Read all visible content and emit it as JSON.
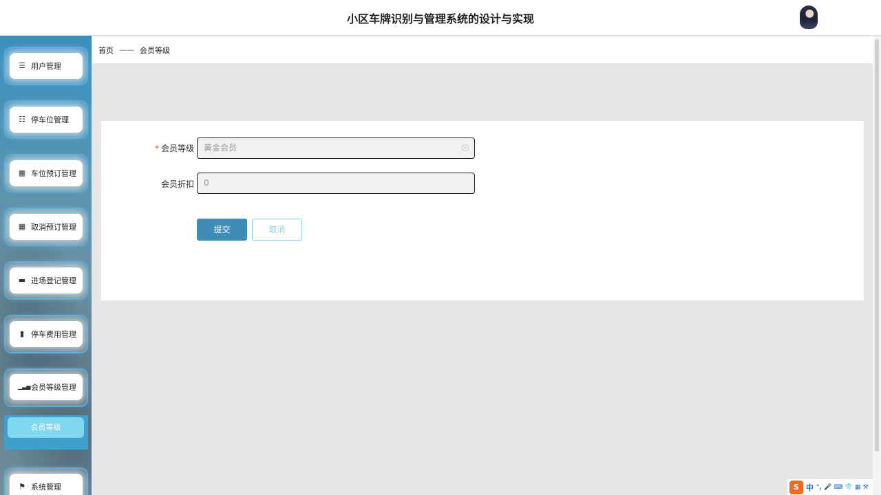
{
  "header": {
    "title": "小区车牌识别与管理系统的设计与实现"
  },
  "sidebar": {
    "items": [
      {
        "label": "用户管理",
        "icon": "☰"
      },
      {
        "label": "停车位管理",
        "icon": "☷"
      },
      {
        "label": "车位预订管理",
        "icon": "▦"
      },
      {
        "label": "取消预订管理",
        "icon": "▦"
      },
      {
        "label": "进场登记管理",
        "icon": "▬"
      },
      {
        "label": "停车费用管理",
        "icon": "▮"
      },
      {
        "label": "会员等级管理",
        "icon": "▁▃▅"
      },
      {
        "label": "系统管理",
        "icon": "⚑"
      }
    ],
    "active_submenu": "会员等级"
  },
  "breadcrumb": {
    "home": "首页",
    "separator": "——",
    "current": "会员等级"
  },
  "form": {
    "level_label": "会员等级",
    "required_mark": "*",
    "level_value": "黄金会员",
    "discount_label": "会员折扣",
    "discount_value": "0",
    "submit_label": "提交",
    "cancel_label": "取消"
  },
  "ime": {
    "logo": "S",
    "lang": "中",
    "extra": "°, 🎤 ⌨ 👕 ▦ ⚒"
  },
  "colors": {
    "primary": "#3d8db8",
    "accent": "#7fd7f0",
    "required": "#e04444"
  }
}
